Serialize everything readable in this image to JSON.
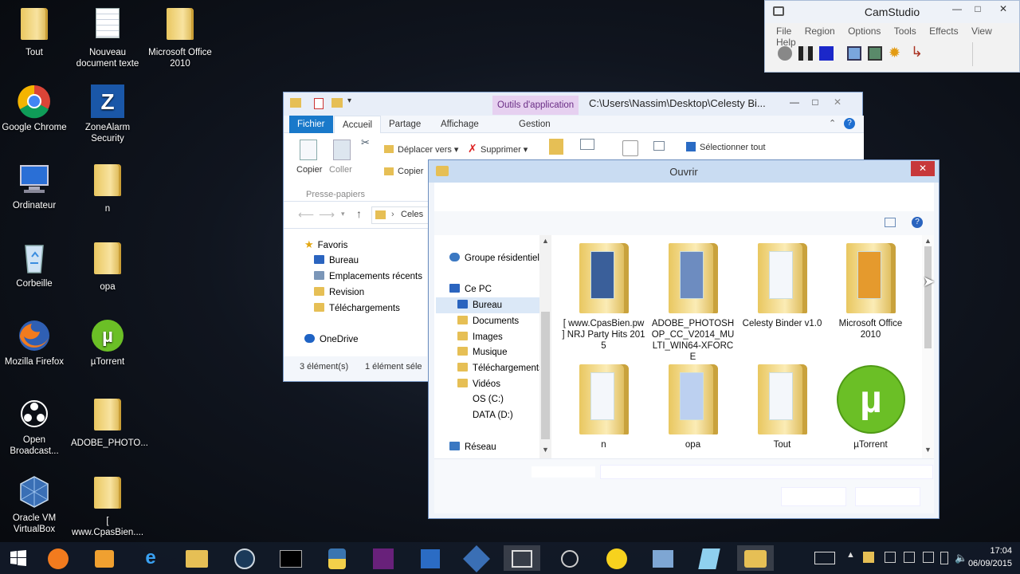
{
  "desktop": {
    "icons": [
      {
        "label": "Tout",
        "type": "folder"
      },
      {
        "label": "Nouveau document texte",
        "type": "doc"
      },
      {
        "label": "Microsoft Office 2010",
        "type": "folder"
      },
      {
        "label": "Google Chrome",
        "type": "chrome"
      },
      {
        "label": "ZoneAlarm Security",
        "type": "zonealarm"
      },
      {
        "label": "Ordinateur",
        "type": "computer"
      },
      {
        "label": "n",
        "type": "folder"
      },
      {
        "label": "Corbeille",
        "type": "recycle"
      },
      {
        "label": "opa",
        "type": "folder"
      },
      {
        "label": "Mozilla Firefox",
        "type": "firefox"
      },
      {
        "label": "µTorrent",
        "type": "utorrent"
      },
      {
        "label": "Open Broadcast...",
        "type": "obs"
      },
      {
        "label": "ADOBE_PHOTO...",
        "type": "folder"
      },
      {
        "label": "Oracle VM VirtualBox",
        "type": "virtualbox"
      },
      {
        "label": "[ www.CpasBien....",
        "type": "folder"
      }
    ]
  },
  "camstudio": {
    "title": "CamStudio",
    "menu": [
      "File",
      "Region",
      "Options",
      "Tools",
      "Effects",
      "View",
      "Help"
    ],
    "toolbar_icons": [
      "record-icon",
      "pause-icon",
      "stop-icon",
      "annotation-icon",
      "screen-icon",
      "settings-icon",
      "cursor-icon"
    ]
  },
  "explorer": {
    "context_tab": "Outils d'application",
    "path_title": "C:\\Users\\Nassim\\Desktop\\Celesty Bi...",
    "tabs": {
      "file": "Fichier",
      "home": "Accueil",
      "share": "Partage",
      "view": "Affichage",
      "manage": "Gestion"
    },
    "ribbon": {
      "copy": "Copier",
      "paste": "Coller",
      "move_to": "Déplacer vers",
      "delete": "Supprimer",
      "select_all": "Sélectionner tout",
      "copy_to": "Copier",
      "group_clipboard": "Presse-papiers"
    },
    "address": "Celes",
    "nav": {
      "favorites": "Favoris",
      "items": [
        "Bureau",
        "Emplacements récents",
        "Revision",
        "Téléchargements"
      ],
      "onedrive": "OneDrive"
    },
    "status": {
      "count": "3 élément(s)",
      "selected": "1 élément séle"
    }
  },
  "open_dialog": {
    "title": "Ouvrir",
    "nav": {
      "homegroup": "Groupe résidentiel",
      "this_pc": "Ce PC",
      "items": [
        "Bureau",
        "Documents",
        "Images",
        "Musique",
        "Téléchargements",
        "Vidéos",
        "OS (C:)",
        "DATA (D:)"
      ],
      "network": "Réseau"
    },
    "files": [
      {
        "label": "[ www.CpasBien.pw ] NRJ Party Hits 2015",
        "kind": "folder"
      },
      {
        "label": "ADOBE_PHOTOSHOP_CC_V2014_MULTI_WIN64-XFORCE",
        "kind": "folder"
      },
      {
        "label": "Celesty Binder v1.0",
        "kind": "folder"
      },
      {
        "label": "Microsoft Office 2010",
        "kind": "folder"
      },
      {
        "label": "n",
        "kind": "folder"
      },
      {
        "label": "opa",
        "kind": "folder"
      },
      {
        "label": "Tout",
        "kind": "folder"
      },
      {
        "label": "µTorrent",
        "kind": "utorrent"
      }
    ]
  },
  "taskbar": {
    "apps": [
      "windows-start",
      "firefox",
      "media",
      "internet-explorer",
      "file-explorer",
      "steam",
      "cmd",
      "python",
      "visual-studio",
      "vb",
      "virtualbox",
      "camstudio",
      "obs",
      "norton",
      "control-panel",
      "notepad",
      "celesty"
    ],
    "time": "17:04",
    "date": "06/09/2015"
  },
  "colors": {
    "accent": "#1979ca",
    "context_tab": "#e6d0f0",
    "close": "#c7383a",
    "utorrent": "#6bbf26"
  }
}
